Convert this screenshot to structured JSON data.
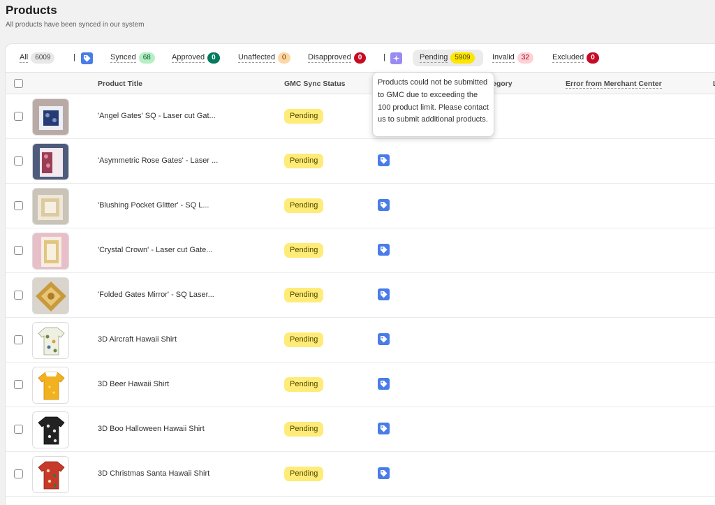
{
  "page": {
    "title": "Products",
    "subtitle": "All products have been synced in our system"
  },
  "filters": {
    "all": {
      "label": "All",
      "count": "6009"
    },
    "synced": {
      "label": "Synced",
      "count": "68"
    },
    "approved": {
      "label": "Approved",
      "count": "0"
    },
    "unaffected": {
      "label": "Unaffected",
      "count": "0"
    },
    "disapproved": {
      "label": "Disapproved",
      "count": "0"
    },
    "pending": {
      "label": "Pending",
      "count": "5909"
    },
    "invalid": {
      "label": "Invalid",
      "count": "32"
    },
    "excluded": {
      "label": "Excluded",
      "count": "0"
    },
    "separator": "|",
    "tag_icon": "google-merchant-tag-icon",
    "sparkle_icon": "sparkle-icon"
  },
  "table": {
    "headers": {
      "product_title": "Product Title",
      "gmc_sync_status": "GMC Sync Status",
      "category": "egory",
      "error": "Error from Merchant Center",
      "last": "L"
    },
    "rows": [
      {
        "title": "'Angel Gates' SQ - Laser cut Gat...",
        "status": "Pending",
        "thumb": "invite-navy"
      },
      {
        "title": "'Asymmetric Rose Gates' - Laser ...",
        "status": "Pending",
        "thumb": "invite-rose"
      },
      {
        "title": "'Blushing Pocket Glitter' - SQ L...",
        "status": "Pending",
        "thumb": "invite-champagne"
      },
      {
        "title": "'Crystal Crown' - Laser cut Gate...",
        "status": "Pending",
        "thumb": "invite-pink"
      },
      {
        "title": "'Folded Gates Mirror' - SQ Laser...",
        "status": "Pending",
        "thumb": "invite-gold"
      },
      {
        "title": "3D Aircraft Hawaii Shirt",
        "status": "Pending",
        "thumb": "shirt-floral"
      },
      {
        "title": "3D Beer Hawaii Shirt",
        "status": "Pending",
        "thumb": "shirt-beer"
      },
      {
        "title": "3D Boo Halloween Hawaii Shirt",
        "status": "Pending",
        "thumb": "shirt-black"
      },
      {
        "title": "3D Christmas Santa Hawaii Shirt",
        "status": "Pending",
        "thumb": "shirt-red"
      }
    ]
  },
  "tooltip": {
    "text": "Products could not be submitted to GMC due to exceeding the 100 product limit. Please contact us to submit additional products."
  },
  "colors": {
    "pending_status_bg": "#ffeb78",
    "tag_icon_blue": "#4a7ce8",
    "sparkle_purple": "#9a8bf2"
  }
}
